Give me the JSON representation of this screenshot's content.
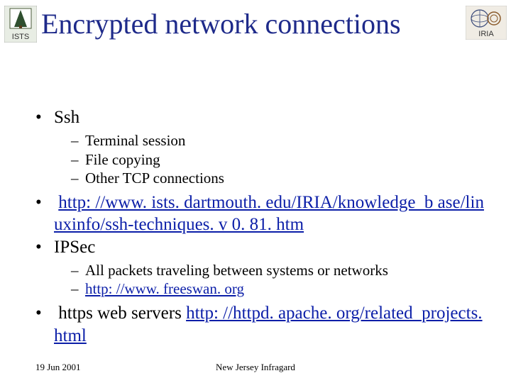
{
  "title": "Encrypted network connections",
  "logos": {
    "left_caption": "ISTS",
    "right_caption": "IRIA"
  },
  "bullets": {
    "ssh": "Ssh",
    "ssh_sub": [
      "Terminal session",
      "File copying",
      "Other TCP connections"
    ],
    "link1": "http: //www. ists. dartmouth. edu/IRIA/knowledge_b ase/linuxinfo/ssh-techniques. v 0. 81. htm",
    "ipsec": "IPSec",
    "ipsec_sub_text": "All packets traveling between systems or networks",
    "ipsec_sub_link": "http: //www. freeswan. org",
    "https_label": "https web servers",
    "https_link": "http: //httpd. apache. org/related_projects. html"
  },
  "footer": {
    "date": "19 Jun 2001",
    "center": "New Jersey Infragard"
  }
}
